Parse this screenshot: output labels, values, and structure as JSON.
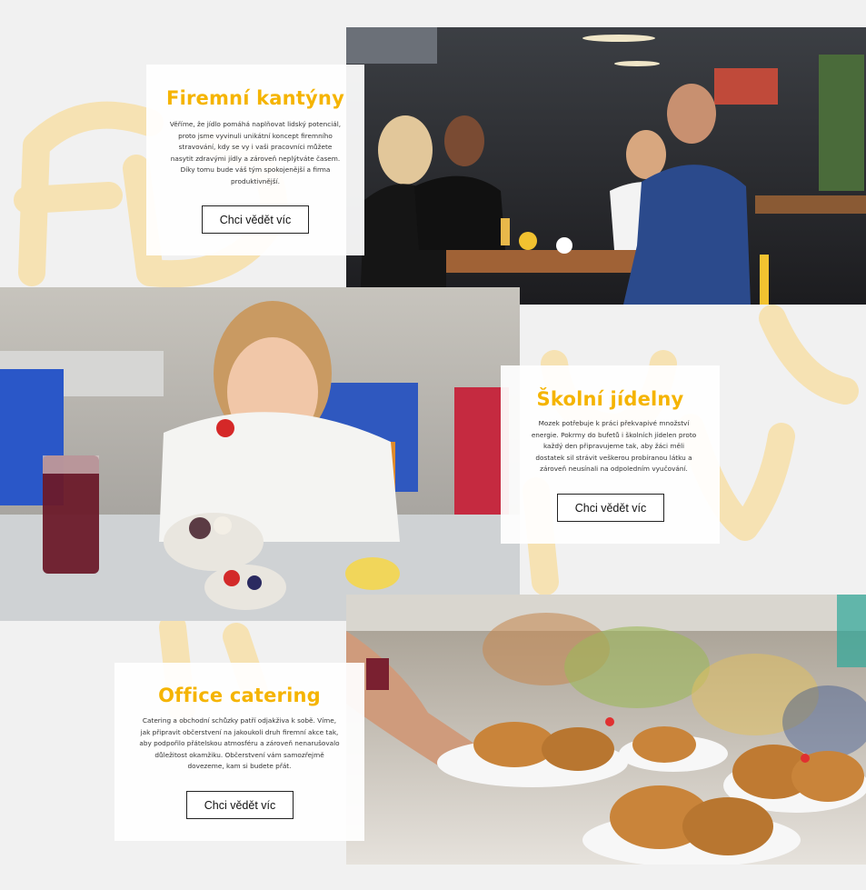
{
  "sections": [
    {
      "title": "Firemní kantýny",
      "text": "Věříme, že jídlo pomáhá naplňovat lidský potenciál, proto jsme vyvinuli unikátní koncept firemního stravování, kdy se vy i vaši pracovníci můžete nasytit zdravými jídly a zároveň neplýtváte časem. Díky tomu bude váš tým spokojenější a firma produktivnější.",
      "button": "Chci vědět víc",
      "photo_icon": "canteen-dining-photo"
    },
    {
      "title": "Školní jídelny",
      "text": "Mozek potřebuje k práci překvapivé množství energie. Pokrmy do bufetů i školních jídelen proto každý den připravujeme tak, aby žáci měli dostatek sil strávit veškerou probíranou látku a zároveň neusínali na odpoledním vyučování.",
      "button": "Chci vědět víc",
      "photo_icon": "school-girl-eating-photo"
    },
    {
      "title": "Office catering",
      "text": "Catering a obchodní schůzky patří odjakživa k sobě. Víme, jak připravit občerstvení na jakoukoli druh firemní akce tak, aby podpořilo přátelskou atmosféru a zároveň nenarušovalo důležitost okamžiku. Občerstvení vám samozřejmě dovezeme, kam si budete přát.",
      "button": "Chci vědět víc",
      "photo_icon": "catering-croissants-photo"
    }
  ],
  "colors": {
    "accent": "#f5b400",
    "background": "#f1f1f1",
    "decor_letters": "#f6e2b3"
  }
}
